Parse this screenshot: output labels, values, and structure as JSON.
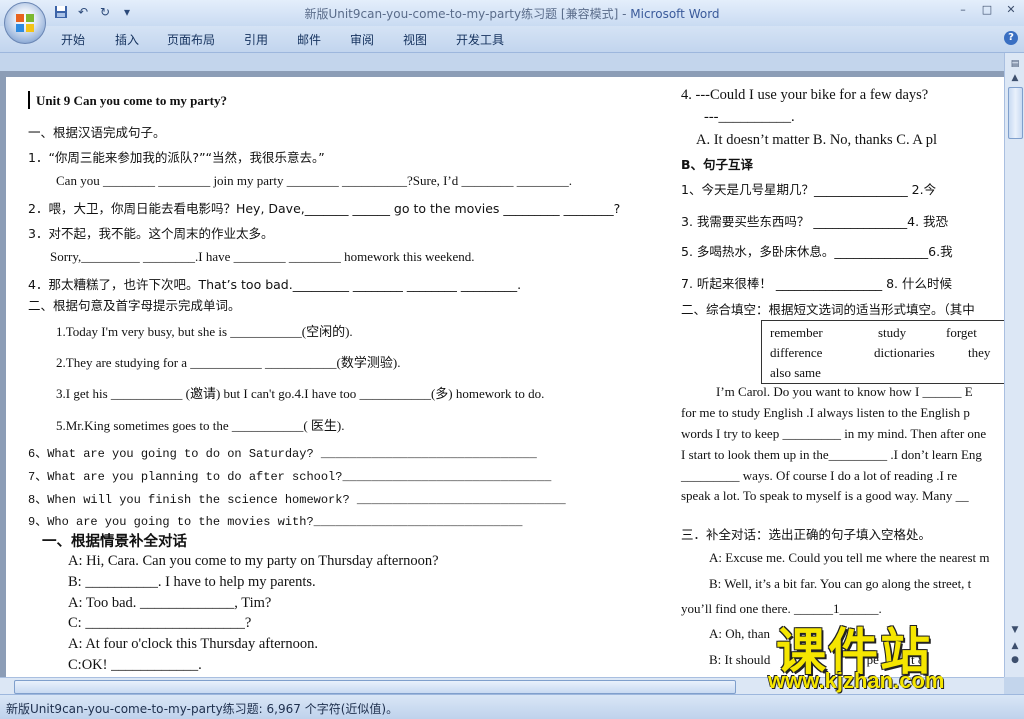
{
  "window": {
    "title": "新版Unit9can-you-come-to-my-party练习题 [兼容模式] - ",
    "app_name": "Microsoft Word",
    "controls": [
      "–",
      "□",
      "✕"
    ]
  },
  "quick_access": [
    "save-icon",
    "undo-icon",
    "redo-icon",
    "customize-icon"
  ],
  "ribbon_tabs": [
    "开始",
    "插入",
    "页面布局",
    "引用",
    "邮件",
    "审阅",
    "视图",
    "开发工具"
  ],
  "left_column": [
    {
      "text": "Unit    9    Can you come to my party?",
      "style": "serif b"
    },
    {
      "text": "一、根据汉语完成句子。",
      "style": "sans"
    },
    {
      "text": "1．“你周三能来参加我的派队?”“当然，我很乐意去。”",
      "style": "sans"
    },
    {
      "text": "Can you ________ ________ join my party ________ __________?Sure, I’d ________ ________.",
      "style": "serif"
    },
    {
      "text": "2．喂，大卫，你周日能去看电影吗？Hey, Dave,_______ ______ go to the movies _________ ________?",
      "style": "sans"
    },
    {
      "text": "3．对不起，我不能。这个周末的作业太多。",
      "style": "sans"
    },
    {
      "text": "Sorry,_________ ________.I have ________ ________ homework this weekend.",
      "style": "serif"
    },
    {
      "text": "4．那太糟糕了，也许下次吧。That’s too bad._________ ________ ________ _________.",
      "style": "sans"
    },
    {
      "text": "二、根据句意及首字母提示完成单词。",
      "style": "sans"
    },
    {
      "text": "1.Today I'm very busy, but she is ___________(空闲的).",
      "style": "serif"
    },
    {
      "text": "2.They are studying for a ___________ ___________(数学测验).",
      "style": "serif"
    },
    {
      "text": "3.I get his ___________ (邀请) but I can't go.4.I have too ___________(多) homework to do.",
      "style": "serif"
    },
    {
      "text": "5.Mr.King sometimes goes to the ___________(  医生).",
      "style": "serif"
    },
    {
      "text": "6、What are you going to do on Saturday? ______________________________",
      "style": "mono"
    },
    {
      "text": "7、What are you planning to do after school?_____________________________",
      "style": "mono"
    },
    {
      "text": "8、When will you finish the science homework? _____________________________",
      "style": "mono"
    },
    {
      "text": "9、Who are you going to the movies with?_____________________________",
      "style": "mono"
    },
    {
      "text": "一、根据情景补全对话",
      "style": "sans b big"
    },
    {
      "text": "A: Hi, Cara. Can you come to my party on Thursday afternoon?",
      "style": "serif big"
    },
    {
      "text": "B: __________. I have to help my parents.",
      "style": "serif big"
    },
    {
      "text": "A: Too bad. _____________, Tim?",
      "style": "serif big"
    },
    {
      "text": "C: ______________________?",
      "style": "serif big"
    },
    {
      "text": "A: At four o'clock this Thursday afternoon.",
      "style": "serif big"
    },
    {
      "text": "C:OK! ____________.",
      "style": "serif big"
    }
  ],
  "right_column": [
    {
      "text": "4.     ---Could I use your bike for a few days?",
      "style": "serif big"
    },
    {
      "text": "---__________.",
      "style": "serif big"
    },
    {
      "text": "A. It doesn’t matter      B. No, thanks        C. A pl",
      "style": "serif big"
    },
    {
      "text": "B、句子互译",
      "style": "sans b"
    },
    {
      "text": "1、今天是几号星期几？_______________        2.今",
      "style": "sans"
    },
    {
      "text": "3. 我需要买些东西吗？ _______________4. 我恐",
      "style": "sans"
    },
    {
      "text": "5.   多喝热水，多卧床休息。_______________6.我",
      "style": "sans"
    },
    {
      "text": "7.   听起来很棒！ _________________       8. 什么时候",
      "style": "sans"
    },
    {
      "text": "二、综合填空：根据短文选词的适当形式填空。（其中",
      "style": "sans"
    },
    {
      "text": "I’m    Carol. Do you want to know how I ______ E",
      "style": "serif"
    },
    {
      "text": "for me to study English .I always listen to the English p",
      "style": "serif"
    },
    {
      "text": "words I try to keep _________ in my mind. Then after one",
      "style": "serif"
    },
    {
      "text": "I start to look them up in the_________ .I don’t learn Eng",
      "style": "serif"
    },
    {
      "text": "_________     ways. Of course I do a lot of reading .I re",
      "style": "serif"
    },
    {
      "text": "speak a lot. To speak to myself is a good way. Many      __",
      "style": "serif"
    },
    {
      "text": "三．补全对话：选出正确的句子填入空格处。",
      "style": "sans"
    },
    {
      "text": "A: Excuse me. Could you tell me where the nearest m",
      "style": "serif"
    },
    {
      "text": "B: Well, it’s a bit far. You can go along the street, t",
      "style": "serif"
    },
    {
      "text": "you’ll find one there. ______1______.",
      "style": "serif"
    },
    {
      "text": "A: Oh, than",
      "style": "serif"
    },
    {
      "text": "B: It should",
      "style": "serif"
    }
  ],
  "word_bank": [
    [
      "remember",
      "study",
      "forget"
    ],
    [
      "difference",
      "dictionaries",
      "they"
    ],
    [
      "also    same",
      "",
      ""
    ]
  ],
  "right_tail": [
    "I pe",
    "t 8:"
  ],
  "status_bar": "新版Unit9can-you-come-to-my-party练习题: 6,967 个字符(近似值)。",
  "watermark": {
    "big": "课件站",
    "url": "www.kjzhan.com"
  }
}
